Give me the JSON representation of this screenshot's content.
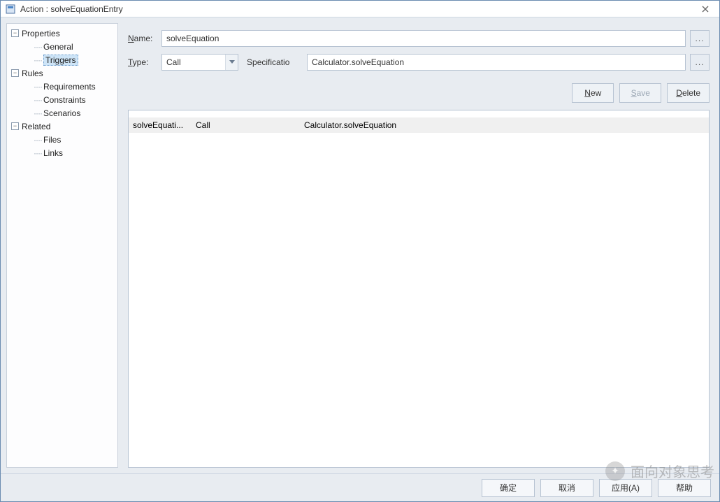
{
  "window": {
    "title": "Action : solveEquationEntry"
  },
  "tree": {
    "properties": {
      "label": "Properties",
      "expanded": true,
      "children": {
        "general": "General",
        "triggers": "Triggers"
      }
    },
    "rules": {
      "label": "Rules",
      "expanded": true,
      "children": {
        "requirements": "Requirements",
        "constraints": "Constraints",
        "scenarios": "Scenarios"
      }
    },
    "related": {
      "label": "Related",
      "expanded": true,
      "children": {
        "files": "Files",
        "links": "Links"
      }
    }
  },
  "form": {
    "name_label_pre": "N",
    "name_label_post": "ame:",
    "name_value": "solveEquation",
    "type_label_pre": "T",
    "type_label_post": "ype:",
    "type_value": "Call",
    "spec_label_pre": "S",
    "spec_label_post": "pecificatio",
    "spec_value": "Calculator.solveEquation"
  },
  "buttons": {
    "new_pre": "N",
    "new_post": "ew",
    "save_pre": "S",
    "save_post": "ave",
    "delete_pre": "D",
    "delete_post": "elete"
  },
  "list": {
    "rows": [
      {
        "c1": "solveEquati...",
        "c2": "Call",
        "c3": "Calculator.solveEquation"
      }
    ]
  },
  "footer": {
    "ok": "确定",
    "cancel": "取消",
    "apply": "应用(A)",
    "help": "帮助"
  },
  "watermark": "面向对象思考"
}
